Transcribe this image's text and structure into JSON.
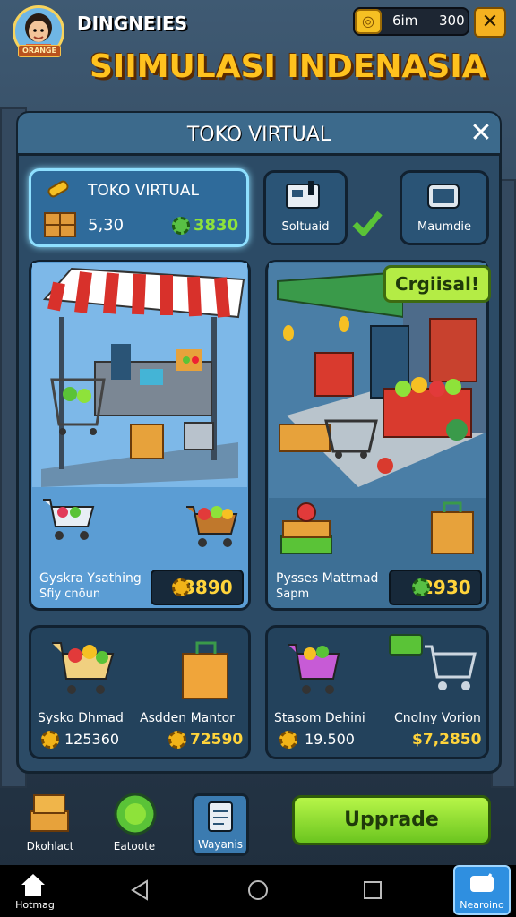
{
  "header": {
    "player_name": "DINGNEIES",
    "avatar_tag": "ORANGE",
    "currency_a": "6im",
    "currency_b": "300",
    "close_label": "✕",
    "game_title": "SIIMULASI INDENASIA"
  },
  "panel": {
    "title": "TOKO VIRTUAL",
    "close_label": "✕"
  },
  "selected_card": {
    "title": "TOKO VIRTUAL",
    "value_a": "5,30",
    "value_b": "3830"
  },
  "tabs": [
    {
      "label": "Soltuaid"
    },
    {
      "label": "Maumdie"
    }
  ],
  "shops": [
    {
      "name_line1": "Gyskra Ysathing",
      "name_line2": "Sfiy cnöun",
      "price": "3890"
    },
    {
      "name_line1": "Pysses Mattmad",
      "name_line2": "Sapm",
      "price": "2930",
      "badge": "Crgiisal!"
    }
  ],
  "items": [
    {
      "name": "Sysko Dhmad",
      "price": "125360"
    },
    {
      "name": "Asdden Mantor",
      "price": "72590"
    },
    {
      "name": "Stasom Dehini",
      "price": "19.500"
    },
    {
      "name": "Cnolny Vorion",
      "price": "$7,2850"
    }
  ],
  "bottom_bar": {
    "btn1": "Dkohlact",
    "btn2": "Eatoote",
    "btn3": "Wayanis",
    "upgrade": "Upprade"
  },
  "nav": {
    "home": "Hotmag",
    "right": "Nearoino"
  },
  "colors": {
    "accent_gold": "#ffc21e",
    "accent_green": "#8ee23a",
    "panel": "#2c4b66"
  }
}
